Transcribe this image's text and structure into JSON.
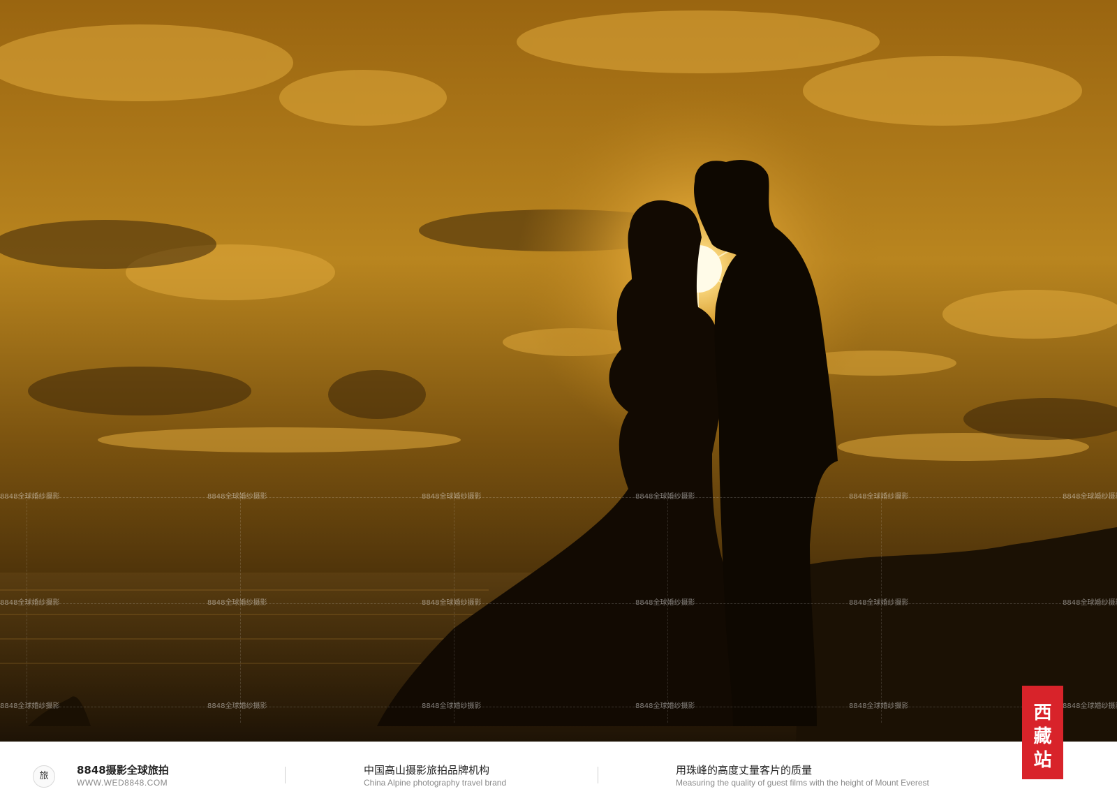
{
  "watermark": {
    "text": "8848全球婚纱摄影"
  },
  "footer": {
    "logo_glyph": "旅",
    "brand_name": "8848摄影全球旅拍",
    "brand_url": "WWW.WED8848.COM",
    "slogan_cn": "中国高山摄影旅拍品牌机构",
    "slogan_en": "China Alpine photography travel brand",
    "motto_cn": "用珠峰的高度丈量客片的质量",
    "motto_en": "Measuring the quality of guest films with the height of Mount Everest"
  },
  "station_badge": {
    "chars": [
      "西",
      "藏",
      "站"
    ]
  },
  "colors": {
    "sky_gold": "#c8901e",
    "sky_dark": "#2a1a06",
    "badge_red": "#d8232a"
  }
}
